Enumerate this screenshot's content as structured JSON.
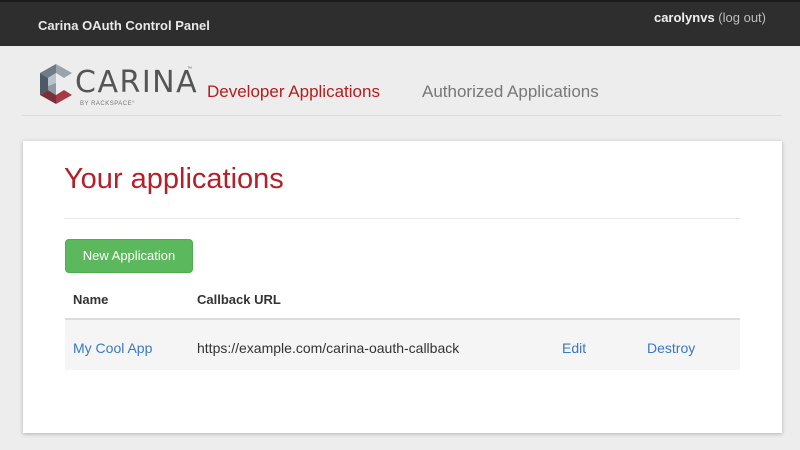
{
  "header": {
    "title": "Carina OAuth Control Panel",
    "username": "carolynvs",
    "logout_label": "(log out)"
  },
  "logo": {
    "wordmark": "CARINA",
    "tm": "™",
    "byline": "BY RACKSPACE°",
    "icon": "carina-logo-icon"
  },
  "nav": {
    "developer_applications": "Developer Applications",
    "authorized_applications": "Authorized Applications"
  },
  "main": {
    "title": "Your applications",
    "new_button_label": "New Application",
    "table": {
      "columns": [
        "Name",
        "Callback URL"
      ],
      "rows": [
        {
          "name": "My Cool App",
          "callback_url": "https://example.com/carina-oauth-callback",
          "edit_label": "Edit",
          "destroy_label": "Destroy"
        }
      ]
    }
  },
  "colors": {
    "topbar": "#2e2e2e",
    "brand_red": "#b71c1c",
    "link_blue": "#3a78c3",
    "button_green": "#5cb85c",
    "page_bg": "#ededed"
  }
}
